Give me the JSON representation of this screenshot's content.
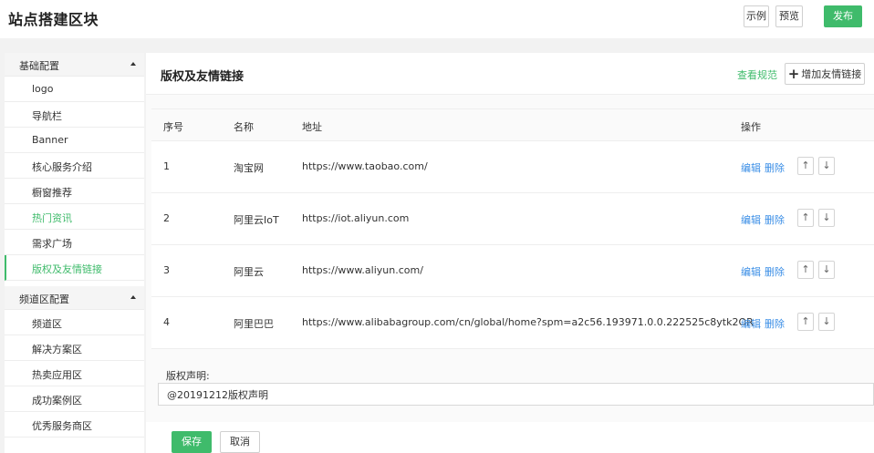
{
  "header": {
    "title": "站点搭建区块",
    "example_label": "示例",
    "preview_label": "预览",
    "publish_label": "发布"
  },
  "sidebar": {
    "groups": [
      {
        "label": "基础配置",
        "items": [
          {
            "label": "logo"
          },
          {
            "label": "导航栏"
          },
          {
            "label": "Banner"
          },
          {
            "label": "核心服务介绍"
          },
          {
            "label": "橱窗推荐"
          },
          {
            "label": "热门资讯"
          },
          {
            "label": "需求广场"
          },
          {
            "label": "版权及友情链接"
          }
        ]
      },
      {
        "label": "频道区配置",
        "items": [
          {
            "label": "频道区"
          },
          {
            "label": "解决方案区"
          },
          {
            "label": "热卖应用区"
          },
          {
            "label": "成功案例区"
          },
          {
            "label": "优秀服务商区"
          }
        ]
      }
    ]
  },
  "main": {
    "title": "版权及友情链接",
    "spec_link": "查看规范",
    "add_button": "增加友情链接",
    "table": {
      "headers": {
        "no": "序号",
        "name": "名称",
        "address": "地址",
        "operation": "操作"
      },
      "rows": [
        {
          "no": "1",
          "name": "淘宝网",
          "address": "https://www.taobao.com/"
        },
        {
          "no": "2",
          "name": "阿里云IoT",
          "address": "https://iot.aliyun.com"
        },
        {
          "no": "3",
          "name": "阿里云",
          "address": "https://www.aliyun.com/"
        },
        {
          "no": "4",
          "name": "阿里巴巴",
          "address": "https://www.alibabagroup.com/cn/global/home?spm=a2c56.193971.0.0.222525c8ytk2OR"
        }
      ],
      "edit_label": "编辑",
      "delete_label": "删除",
      "up_glyph": "↑",
      "down_glyph": "↓"
    },
    "copyright_label": "版权声明:",
    "copyright_value": "@20191212版权声明",
    "save_label": "保存",
    "cancel_label": "取消"
  },
  "colors": {
    "accent": "#3fbb6b",
    "link": "#3a8ee6"
  }
}
